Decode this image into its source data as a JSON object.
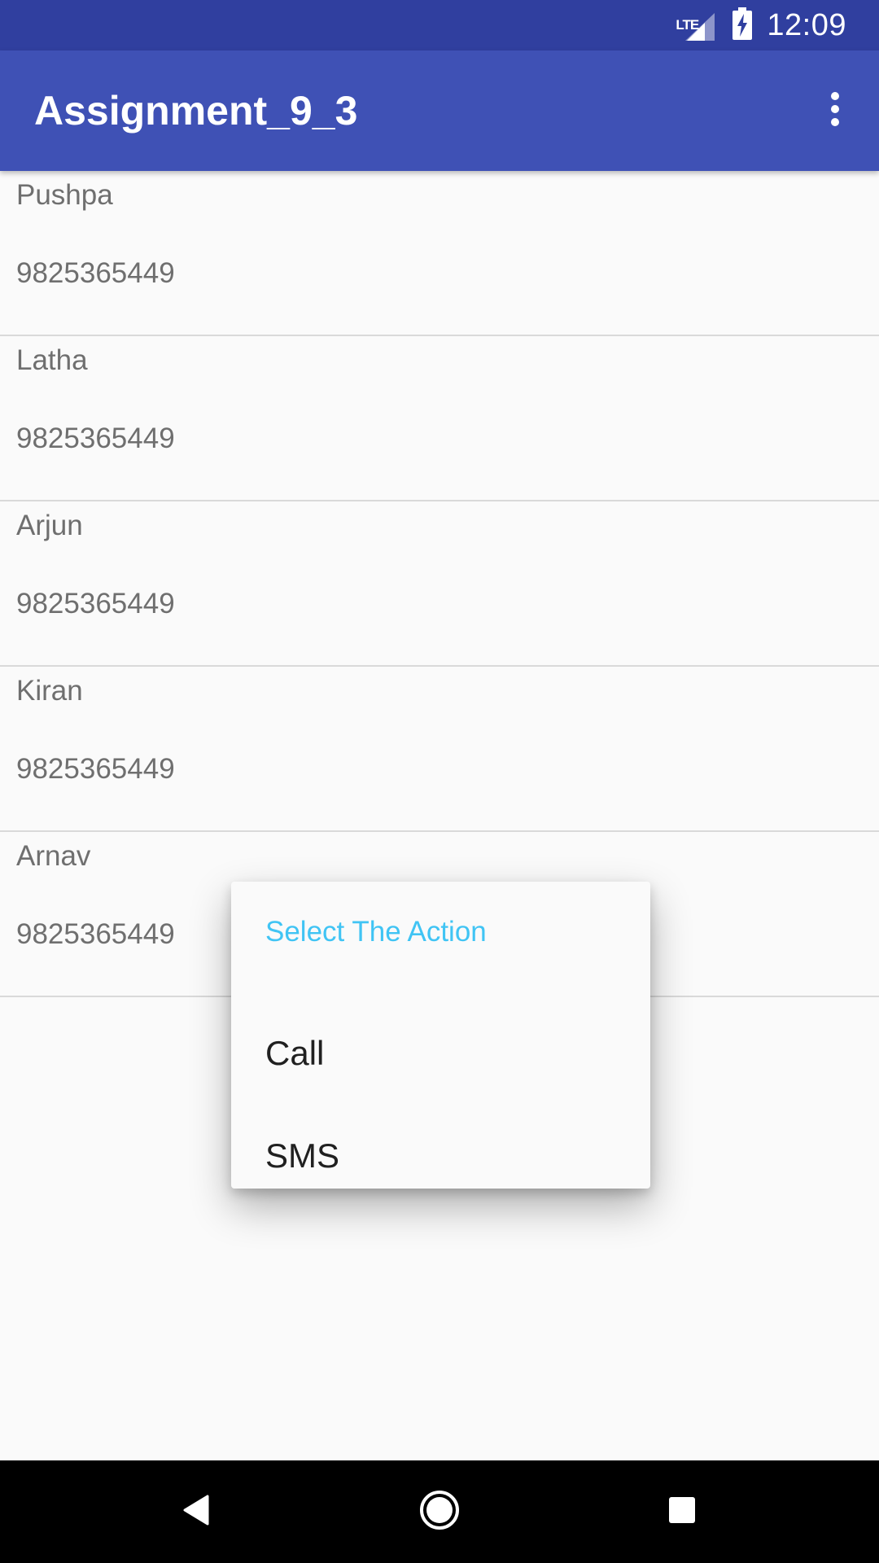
{
  "status_bar": {
    "network_label": "LTE",
    "time": "12:09",
    "icons": [
      "lte-signal-icon",
      "battery-charging-icon"
    ]
  },
  "app_bar": {
    "title": "Assignment_9_3",
    "overflow_icon": "more-vert-icon"
  },
  "contacts": [
    {
      "name": "Pushpa",
      "phone": "9825365449"
    },
    {
      "name": "Latha",
      "phone": "9825365449"
    },
    {
      "name": "Arjun",
      "phone": "9825365449"
    },
    {
      "name": "Kiran",
      "phone": "9825365449"
    },
    {
      "name": "Arnav",
      "phone": "9825365449"
    }
  ],
  "context_menu": {
    "title": "Select The Action",
    "items": [
      {
        "label": "Call"
      },
      {
        "label": "SMS"
      }
    ]
  },
  "nav_bar": {
    "icons": [
      "back-icon",
      "home-icon",
      "recents-icon"
    ]
  },
  "colors": {
    "status_bar": "#303f9f",
    "app_bar": "#3f51b5",
    "menu_title": "#40c4f4",
    "list_text": "#6f6f6f"
  }
}
